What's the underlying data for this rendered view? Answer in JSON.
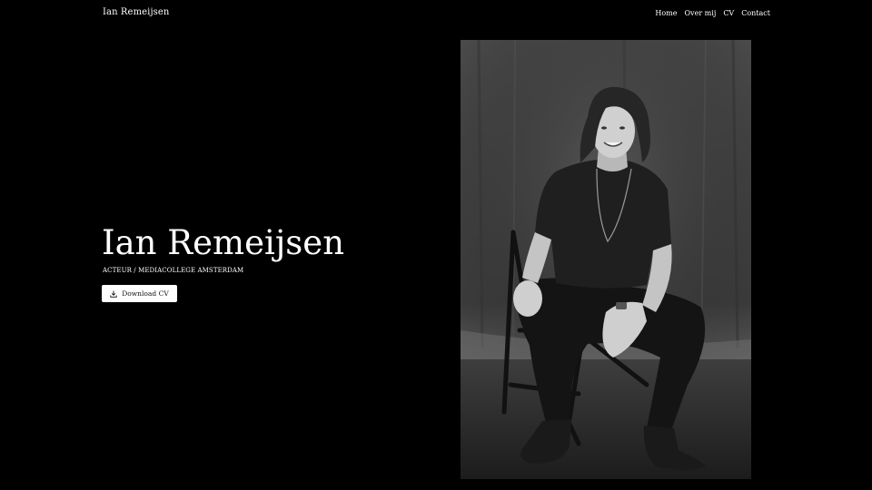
{
  "header": {
    "brand": "Ian Remeijsen",
    "nav": [
      "Home",
      "Over mij",
      "CV",
      "Contact"
    ]
  },
  "hero": {
    "title": "Ian Remeijsen",
    "subtitle": "ACTEUR / MEDIACOLLEGE AMSTERDAM",
    "download_label": "Download CV",
    "download_icon": "download-icon"
  },
  "photo": {
    "subject": "portrait",
    "style": "black-and-white"
  },
  "colors": {
    "background": "#000000",
    "text": "#ffffff",
    "button_bg": "#ffffff",
    "button_text": "#111111"
  }
}
